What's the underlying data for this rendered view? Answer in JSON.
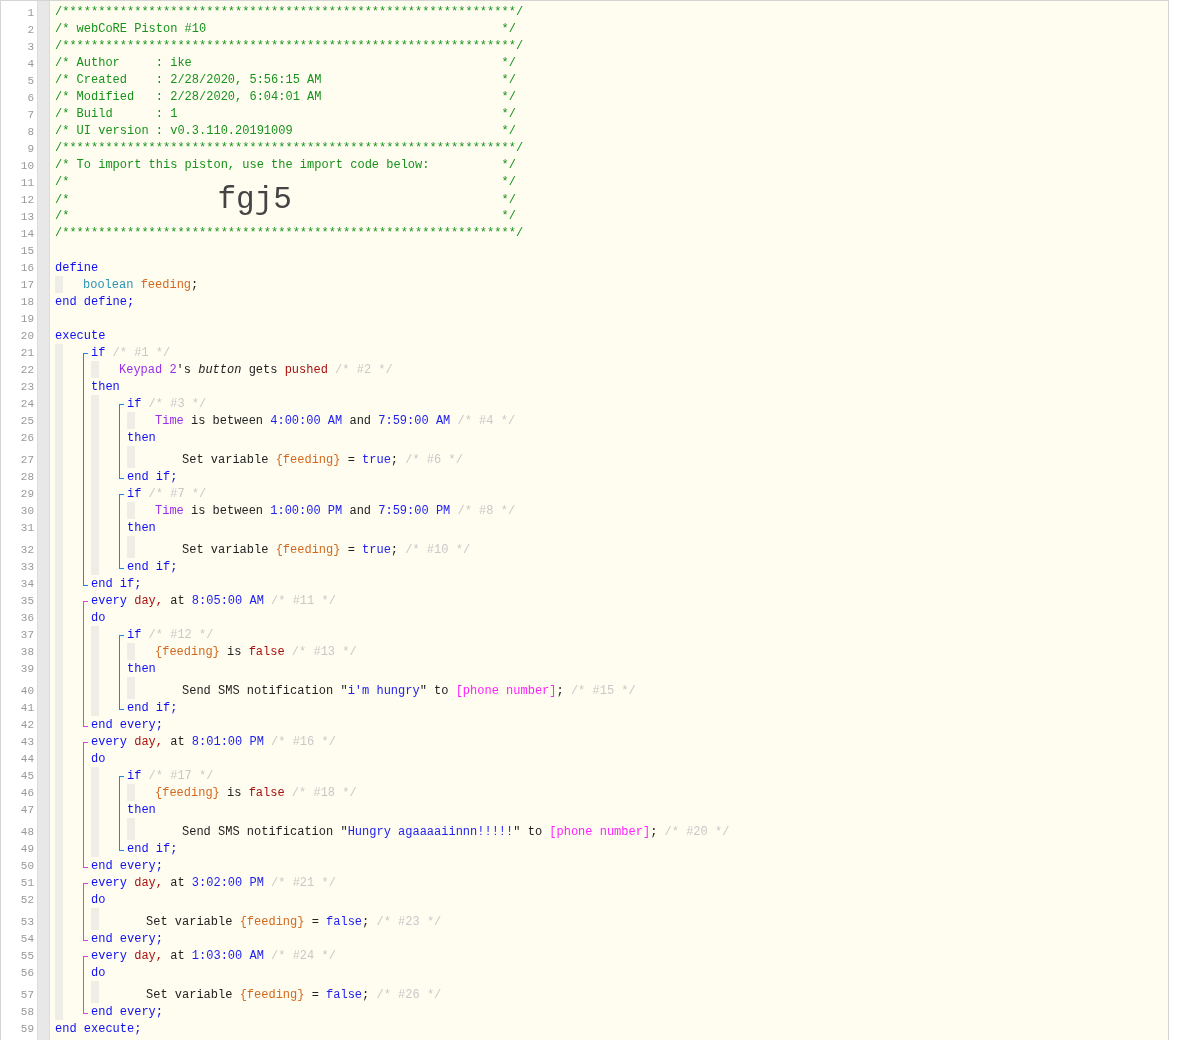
{
  "editor": {
    "lines": [
      {
        "kind": "header",
        "number": "1",
        "tokens": [
          {
            "kind": "comment",
            "text": "/***************************************************************/"
          }
        ]
      },
      {
        "kind": "header",
        "number": "2",
        "tokens": [
          {
            "kind": "comment",
            "text": "/* webCoRE Piston #10"
          },
          {
            "kind": "comment",
            "text": "*/"
          }
        ]
      },
      {
        "kind": "header",
        "number": "3",
        "tokens": [
          {
            "kind": "comment",
            "text": "/***************************************************************/"
          }
        ]
      },
      {
        "kind": "header",
        "number": "4",
        "tokens": [
          {
            "kind": "comment",
            "text": "/* Author     : ike"
          },
          {
            "kind": "comment",
            "text": "*/"
          }
        ]
      },
      {
        "kind": "header",
        "number": "5",
        "tokens": [
          {
            "kind": "comment",
            "text": "/* Created    : 2/28/2020, 5:56:15 AM"
          },
          {
            "kind": "comment",
            "text": "*/"
          }
        ]
      },
      {
        "kind": "header",
        "number": "6",
        "tokens": [
          {
            "kind": "comment",
            "text": "/* Modified   : 2/28/2020, 6:04:01 AM"
          },
          {
            "kind": "comment",
            "text": "*/"
          }
        ]
      },
      {
        "kind": "header",
        "number": "7",
        "tokens": [
          {
            "kind": "comment",
            "text": "/* Build      : 1"
          },
          {
            "kind": "comment",
            "text": "*/"
          }
        ]
      },
      {
        "kind": "header",
        "number": "8",
        "tokens": [
          {
            "kind": "comment",
            "text": "/* UI version : v0.3.110.20191009"
          },
          {
            "kind": "comment",
            "text": "*/"
          }
        ]
      },
      {
        "kind": "header",
        "number": "9",
        "tokens": [
          {
            "kind": "comment",
            "text": "/***************************************************************/"
          }
        ]
      },
      {
        "kind": "header",
        "number": "10",
        "tokens": [
          {
            "kind": "comment",
            "text": "/* To import this piston, use the import code below:"
          },
          {
            "kind": "comment",
            "text": "*/"
          }
        ]
      },
      {
        "kind": "header",
        "number": "11",
        "tokens": [
          {
            "kind": "comment",
            "text": "/*"
          },
          {
            "kind": "comment",
            "text": "*/"
          }
        ]
      },
      {
        "kind": "header",
        "number": "12",
        "tokens": [
          {
            "kind": "comment",
            "text": "/*"
          },
          {
            "kind": "code",
            "text": "fgj5"
          },
          {
            "kind": "comment",
            "text": "*/"
          }
        ]
      },
      {
        "kind": "header",
        "number": "13",
        "tokens": [
          {
            "kind": "comment",
            "text": "/*"
          },
          {
            "kind": "comment",
            "text": "*/"
          }
        ]
      },
      {
        "kind": "header",
        "number": "14",
        "tokens": [
          {
            "kind": "comment",
            "text": "/***************************************************************/"
          }
        ]
      },
      {
        "kind": "line",
        "number": "15"
      },
      {
        "kind": "line",
        "number": "16",
        "tokens": [
          {
            "kind": "keyword",
            "text": "define"
          }
        ]
      },
      {
        "kind": "body",
        "children": [
          {
            "kind": "line",
            "number": "17",
            "tokens": [
              {
                "kind": "type",
                "text": "boolean"
              },
              {
                "kind": "variable",
                "text": "feeding"
              },
              {
                "kind": "plain",
                "text": ";",
                "glued": true
              }
            ]
          }
        ]
      },
      {
        "kind": "line",
        "number": "18",
        "tokens": [
          {
            "kind": "keyword",
            "text": "end define;"
          }
        ]
      },
      {
        "kind": "line",
        "number": "19"
      },
      {
        "kind": "line",
        "number": "20",
        "tokens": [
          {
            "kind": "keyword",
            "text": "execute"
          }
        ]
      },
      {
        "kind": "body",
        "children": [
          {
            "kind": "block",
            "color": "#1e88e5",
            "children": [
              {
                "kind": "line",
                "number": "21",
                "tokens": [
                  {
                    "kind": "keyword",
                    "text": "if"
                  },
                  {
                    "kind": "meta",
                    "text": "/* #1 */"
                  }
                ]
              },
              {
                "kind": "body",
                "children": [
                  {
                    "kind": "line",
                    "number": "22",
                    "tokens": [
                      {
                        "kind": "device",
                        "text": "Keypad 2"
                      },
                      {
                        "kind": "plain",
                        "text": "'s",
                        "glued": true
                      },
                      {
                        "kind": "attribute",
                        "text": "button"
                      },
                      {
                        "kind": "plain",
                        "text": "gets"
                      },
                      {
                        "kind": "event",
                        "text": "pushed"
                      },
                      {
                        "kind": "meta",
                        "text": "/* #2 */"
                      }
                    ]
                  }
                ]
              },
              {
                "kind": "line",
                "number": "23",
                "tokens": [
                  {
                    "kind": "keyword",
                    "text": "then"
                  }
                ]
              },
              {
                "kind": "body",
                "children": [
                  {
                    "kind": "block",
                    "color": "#1e88e5",
                    "children": [
                      {
                        "kind": "line",
                        "number": "24",
                        "tokens": [
                          {
                            "kind": "keyword",
                            "text": "if"
                          },
                          {
                            "kind": "meta",
                            "text": "/* #3 */"
                          }
                        ]
                      },
                      {
                        "kind": "body",
                        "children": [
                          {
                            "kind": "line",
                            "number": "25",
                            "tokens": [
                              {
                                "kind": "device",
                                "text": "Time"
                              },
                              {
                                "kind": "plain",
                                "text": "is between"
                              },
                              {
                                "kind": "value",
                                "text": "4:00:00 AM"
                              },
                              {
                                "kind": "plain",
                                "text": "and"
                              },
                              {
                                "kind": "value",
                                "text": "7:59:00 AM"
                              },
                              {
                                "kind": "meta",
                                "text": "/* #4 */"
                              }
                            ]
                          }
                        ]
                      },
                      {
                        "kind": "line",
                        "number": "26",
                        "tokens": [
                          {
                            "kind": "keyword",
                            "text": "then"
                          }
                        ]
                      },
                      {
                        "kind": "body",
                        "children": [
                          {
                            "kind": "action",
                            "number": "27",
                            "tokens": [
                              {
                                "kind": "plain",
                                "text": "Set variable"
                              },
                              {
                                "kind": "variable",
                                "text": "{feeding}"
                              },
                              {
                                "kind": "plain",
                                "text": "="
                              },
                              {
                                "kind": "value",
                                "text": "true"
                              },
                              {
                                "kind": "plain",
                                "text": ";",
                                "glued": true
                              },
                              {
                                "kind": "meta",
                                "text": "/* #6 */"
                              }
                            ]
                          }
                        ]
                      },
                      {
                        "kind": "line",
                        "number": "28",
                        "tokens": [
                          {
                            "kind": "keyword",
                            "text": "end if;"
                          }
                        ]
                      }
                    ]
                  },
                  {
                    "kind": "block",
                    "color": "#1e88e5",
                    "children": [
                      {
                        "kind": "line",
                        "number": "29",
                        "tokens": [
                          {
                            "kind": "keyword",
                            "text": "if"
                          },
                          {
                            "kind": "meta",
                            "text": "/* #7 */"
                          }
                        ]
                      },
                      {
                        "kind": "body",
                        "children": [
                          {
                            "kind": "line",
                            "number": "30",
                            "tokens": [
                              {
                                "kind": "device",
                                "text": "Time"
                              },
                              {
                                "kind": "plain",
                                "text": "is between"
                              },
                              {
                                "kind": "value",
                                "text": "1:00:00 PM"
                              },
                              {
                                "kind": "plain",
                                "text": "and"
                              },
                              {
                                "kind": "value",
                                "text": "7:59:00 PM"
                              },
                              {
                                "kind": "meta",
                                "text": "/* #8 */"
                              }
                            ]
                          }
                        ]
                      },
                      {
                        "kind": "line",
                        "number": "31",
                        "tokens": [
                          {
                            "kind": "keyword",
                            "text": "then"
                          }
                        ]
                      },
                      {
                        "kind": "body",
                        "children": [
                          {
                            "kind": "action",
                            "number": "32",
                            "tokens": [
                              {
                                "kind": "plain",
                                "text": "Set variable"
                              },
                              {
                                "kind": "variable",
                                "text": "{feeding}"
                              },
                              {
                                "kind": "plain",
                                "text": "="
                              },
                              {
                                "kind": "value",
                                "text": "true"
                              },
                              {
                                "kind": "plain",
                                "text": ";",
                                "glued": true
                              },
                              {
                                "kind": "meta",
                                "text": "/* #10 */"
                              }
                            ]
                          }
                        ]
                      },
                      {
                        "kind": "line",
                        "number": "33",
                        "tokens": [
                          {
                            "kind": "keyword",
                            "text": "end if;"
                          }
                        ]
                      }
                    ]
                  }
                ]
              },
              {
                "kind": "line",
                "number": "34",
                "tokens": [
                  {
                    "kind": "keyword",
                    "text": "end if;"
                  }
                ]
              }
            ]
          },
          {
            "kind": "block",
            "color": "#e040e0",
            "children": [
              {
                "kind": "line",
                "number": "35",
                "tokens": [
                  {
                    "kind": "keyword",
                    "text": "every"
                  },
                  {
                    "kind": "event",
                    "text": "day,"
                  },
                  {
                    "kind": "plain",
                    "text": "at"
                  },
                  {
                    "kind": "value",
                    "text": "8:05:00 AM"
                  },
                  {
                    "kind": "meta",
                    "text": "/* #11 */"
                  }
                ]
              },
              {
                "kind": "line",
                "number": "36",
                "tokens": [
                  {
                    "kind": "keyword",
                    "text": "do"
                  }
                ]
              },
              {
                "kind": "body",
                "children": [
                  {
                    "kind": "block",
                    "color": "#1e88e5",
                    "children": [
                      {
                        "kind": "line",
                        "number": "37",
                        "tokens": [
                          {
                            "kind": "keyword",
                            "text": "if"
                          },
                          {
                            "kind": "meta",
                            "text": "/* #12 */"
                          }
                        ]
                      },
                      {
                        "kind": "body",
                        "children": [
                          {
                            "kind": "line",
                            "number": "38",
                            "tokens": [
                              {
                                "kind": "variable",
                                "text": "{feeding}"
                              },
                              {
                                "kind": "plain",
                                "text": "is"
                              },
                              {
                                "kind": "event",
                                "text": "false"
                              },
                              {
                                "kind": "meta",
                                "text": "/* #13 */"
                              }
                            ]
                          }
                        ]
                      },
                      {
                        "kind": "line",
                        "number": "39",
                        "tokens": [
                          {
                            "kind": "keyword",
                            "text": "then"
                          }
                        ]
                      },
                      {
                        "kind": "body",
                        "children": [
                          {
                            "kind": "action",
                            "number": "40",
                            "tokens": [
                              {
                                "kind": "plain",
                                "text": "Send SMS notification"
                              },
                              {
                                "kind": "plain",
                                "text": "\""
                              },
                              {
                                "kind": "value",
                                "text": "i'm hungry",
                                "glued": true
                              },
                              {
                                "kind": "plain",
                                "text": "\"",
                                "glued": true
                              },
                              {
                                "kind": "plain",
                                "text": "to"
                              },
                              {
                                "kind": "phone",
                                "text": "[phone number]"
                              },
                              {
                                "kind": "plain",
                                "text": ";",
                                "glued": true
                              },
                              {
                                "kind": "meta",
                                "text": "/* #15 */"
                              }
                            ]
                          }
                        ]
                      },
                      {
                        "kind": "line",
                        "number": "41",
                        "tokens": [
                          {
                            "kind": "keyword",
                            "text": "end if;"
                          }
                        ]
                      }
                    ]
                  }
                ]
              },
              {
                "kind": "line",
                "number": "42",
                "tokens": [
                  {
                    "kind": "keyword",
                    "text": "end every;"
                  }
                ]
              }
            ]
          },
          {
            "kind": "block",
            "color": "#e040e0",
            "children": [
              {
                "kind": "line",
                "number": "43",
                "tokens": [
                  {
                    "kind": "keyword",
                    "text": "every"
                  },
                  {
                    "kind": "event",
                    "text": "day,"
                  },
                  {
                    "kind": "plain",
                    "text": "at"
                  },
                  {
                    "kind": "value",
                    "text": "8:01:00 PM"
                  },
                  {
                    "kind": "meta",
                    "text": "/* #16 */"
                  }
                ]
              },
              {
                "kind": "line",
                "number": "44",
                "tokens": [
                  {
                    "kind": "keyword",
                    "text": "do"
                  }
                ]
              },
              {
                "kind": "body",
                "children": [
                  {
                    "kind": "block",
                    "color": "#1e88e5",
                    "children": [
                      {
                        "kind": "line",
                        "number": "45",
                        "tokens": [
                          {
                            "kind": "keyword",
                            "text": "if"
                          },
                          {
                            "kind": "meta",
                            "text": "/* #17 */"
                          }
                        ]
                      },
                      {
                        "kind": "body",
                        "children": [
                          {
                            "kind": "line",
                            "number": "46",
                            "tokens": [
                              {
                                "kind": "variable",
                                "text": "{feeding}"
                              },
                              {
                                "kind": "plain",
                                "text": "is"
                              },
                              {
                                "kind": "event",
                                "text": "false"
                              },
                              {
                                "kind": "meta",
                                "text": "/* #18 */"
                              }
                            ]
                          }
                        ]
                      },
                      {
                        "kind": "line",
                        "number": "47",
                        "tokens": [
                          {
                            "kind": "keyword",
                            "text": "then"
                          }
                        ]
                      },
                      {
                        "kind": "body",
                        "children": [
                          {
                            "kind": "action",
                            "number": "48",
                            "tokens": [
                              {
                                "kind": "plain",
                                "text": "Send SMS notification"
                              },
                              {
                                "kind": "plain",
                                "text": "\""
                              },
                              {
                                "kind": "value",
                                "text": "Hungry agaaaaiinnn!!!!!",
                                "glued": true
                              },
                              {
                                "kind": "plain",
                                "text": "\"",
                                "glued": true
                              },
                              {
                                "kind": "plain",
                                "text": "to"
                              },
                              {
                                "kind": "phone",
                                "text": "[phone number]"
                              },
                              {
                                "kind": "plain",
                                "text": ";",
                                "glued": true
                              },
                              {
                                "kind": "meta",
                                "text": "/* #20 */"
                              }
                            ]
                          }
                        ]
                      },
                      {
                        "kind": "line",
                        "number": "49",
                        "tokens": [
                          {
                            "kind": "keyword",
                            "text": "end if;"
                          }
                        ]
                      }
                    ]
                  }
                ]
              },
              {
                "kind": "line",
                "number": "50",
                "tokens": [
                  {
                    "kind": "keyword",
                    "text": "end every;"
                  }
                ]
              }
            ]
          },
          {
            "kind": "block",
            "color": "#e040e0",
            "children": [
              {
                "kind": "line",
                "number": "51",
                "tokens": [
                  {
                    "kind": "keyword",
                    "text": "every"
                  },
                  {
                    "kind": "event",
                    "text": "day,"
                  },
                  {
                    "kind": "plain",
                    "text": "at"
                  },
                  {
                    "kind": "value",
                    "text": "3:02:00 PM"
                  },
                  {
                    "kind": "meta",
                    "text": "/* #21 */"
                  }
                ]
              },
              {
                "kind": "line",
                "number": "52",
                "tokens": [
                  {
                    "kind": "keyword",
                    "text": "do"
                  }
                ]
              },
              {
                "kind": "body",
                "children": [
                  {
                    "kind": "action",
                    "number": "53",
                    "tokens": [
                      {
                        "kind": "plain",
                        "text": "Set variable"
                      },
                      {
                        "kind": "variable",
                        "text": "{feeding}"
                      },
                      {
                        "kind": "plain",
                        "text": "="
                      },
                      {
                        "kind": "value",
                        "text": "false"
                      },
                      {
                        "kind": "plain",
                        "text": ";",
                        "glued": true
                      },
                      {
                        "kind": "meta",
                        "text": "/* #23 */"
                      }
                    ]
                  }
                ]
              },
              {
                "kind": "line",
                "number": "54",
                "tokens": [
                  {
                    "kind": "keyword",
                    "text": "end every;"
                  }
                ]
              }
            ]
          },
          {
            "kind": "block",
            "color": "#e040e0",
            "children": [
              {
                "kind": "line",
                "number": "55",
                "tokens": [
                  {
                    "kind": "keyword",
                    "text": "every"
                  },
                  {
                    "kind": "event",
                    "text": "day,"
                  },
                  {
                    "kind": "plain",
                    "text": "at"
                  },
                  {
                    "kind": "value",
                    "text": "1:03:00 AM"
                  },
                  {
                    "kind": "meta",
                    "text": "/* #24 */"
                  }
                ]
              },
              {
                "kind": "line",
                "number": "56",
                "tokens": [
                  {
                    "kind": "keyword",
                    "text": "do"
                  }
                ]
              },
              {
                "kind": "body",
                "children": [
                  {
                    "kind": "action",
                    "number": "57",
                    "tokens": [
                      {
                        "kind": "plain",
                        "text": "Set variable"
                      },
                      {
                        "kind": "variable",
                        "text": "{feeding}"
                      },
                      {
                        "kind": "plain",
                        "text": "="
                      },
                      {
                        "kind": "value",
                        "text": "false"
                      },
                      {
                        "kind": "plain",
                        "text": ";",
                        "glued": true
                      },
                      {
                        "kind": "meta",
                        "text": "/* #26 */"
                      }
                    ]
                  }
                ]
              },
              {
                "kind": "line",
                "number": "58",
                "tokens": [
                  {
                    "kind": "keyword",
                    "text": "end every;"
                  }
                ]
              }
            ]
          }
        ]
      },
      {
        "kind": "line",
        "number": "59",
        "tokens": [
          {
            "kind": "keyword",
            "text": "end execute;"
          }
        ]
      }
    ]
  }
}
